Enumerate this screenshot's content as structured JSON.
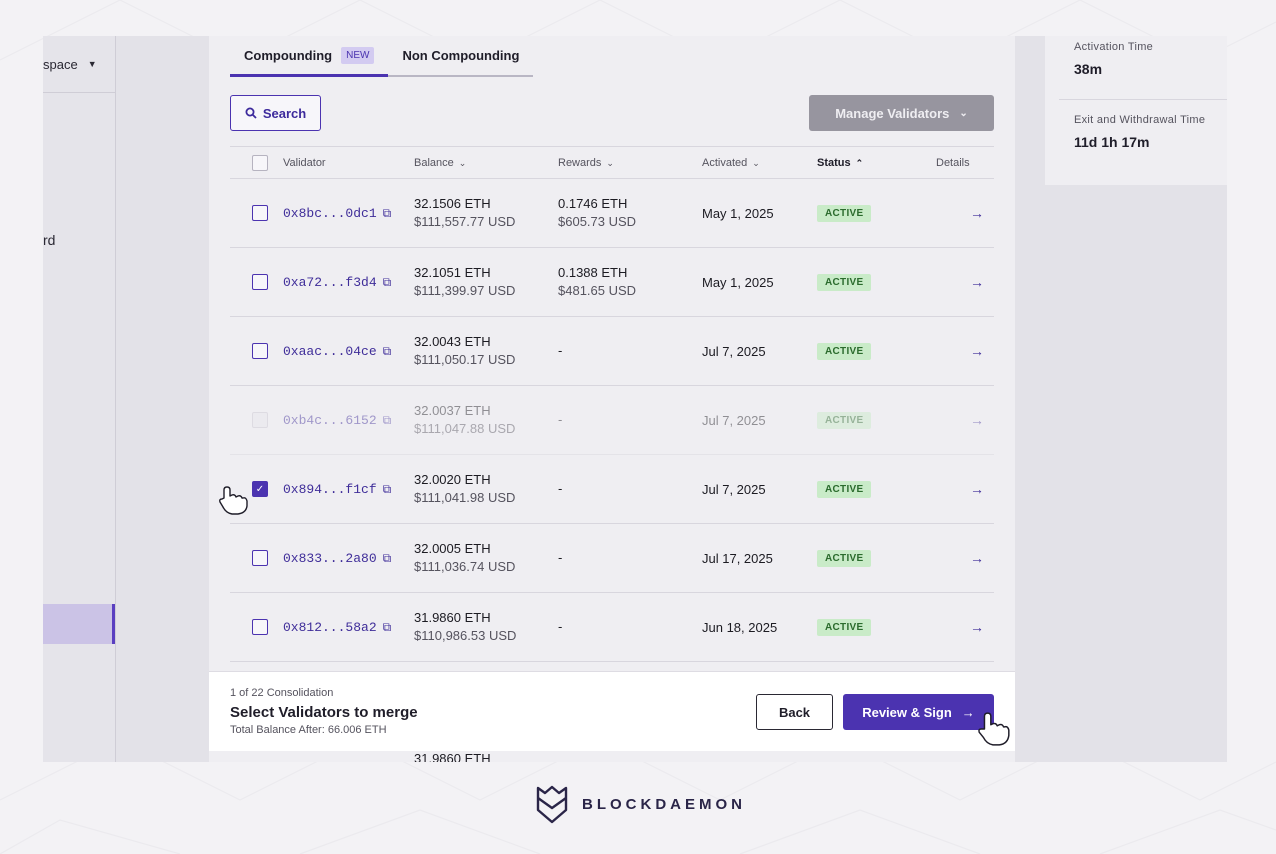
{
  "sidebar": {
    "workspace_label": "space",
    "partial_item": "rd"
  },
  "tabs": [
    {
      "label": "Compounding",
      "badge": "NEW"
    },
    {
      "label": "Non Compounding"
    }
  ],
  "toolbar": {
    "search_label": "Search",
    "manage_label": "Manage Validators"
  },
  "table": {
    "headers": {
      "validator": "Validator",
      "balance": "Balance",
      "rewards": "Rewards",
      "activated": "Activated",
      "status": "Status",
      "details": "Details"
    },
    "rows": [
      {
        "address": "0x8bc...0dc1",
        "balance_eth": "32.1506 ETH",
        "balance_usd": "$111,557.77 USD",
        "rewards_eth": "0.1746 ETH",
        "rewards_usd": "$605.73 USD",
        "activated": "May 1, 2025",
        "status": "ACTIVE"
      },
      {
        "address": "0xa72...f3d4",
        "balance_eth": "32.1051 ETH",
        "balance_usd": "$111,399.97 USD",
        "rewards_eth": "0.1388 ETH",
        "rewards_usd": "$481.65 USD",
        "activated": "May 1, 2025",
        "status": "ACTIVE"
      },
      {
        "address": "0xaac...04ce",
        "balance_eth": "32.0043 ETH",
        "balance_usd": "$111,050.17 USD",
        "rewards_eth": "-",
        "rewards_usd": "",
        "activated": "Jul 7, 2025",
        "status": "ACTIVE"
      },
      {
        "address": "0xb4c...6152",
        "balance_eth": "32.0037 ETH",
        "balance_usd": "$111,047.88 USD",
        "rewards_eth": "-",
        "rewards_usd": "",
        "activated": "Jul 7, 2025",
        "status": "ACTIVE"
      },
      {
        "address": "0x894...f1cf",
        "balance_eth": "32.0020 ETH",
        "balance_usd": "$111,041.98 USD",
        "rewards_eth": "-",
        "rewards_usd": "",
        "activated": "Jul 7, 2025",
        "status": "ACTIVE"
      },
      {
        "address": "0x833...2a80",
        "balance_eth": "32.0005 ETH",
        "balance_usd": "$111,036.74 USD",
        "rewards_eth": "-",
        "rewards_usd": "",
        "activated": "Jul 17, 2025",
        "status": "ACTIVE"
      },
      {
        "address": "0x812...58a2",
        "balance_eth": "31.9860 ETH",
        "balance_usd": "$110,986.53 USD",
        "rewards_eth": "-",
        "rewards_usd": "",
        "activated": "Jun 18, 2025",
        "status": "ACTIVE"
      }
    ],
    "peek_row": {
      "balance_eth": "31.9860 ETH"
    }
  },
  "footer": {
    "progress": "1 of 22 Consolidation",
    "title": "Select Validators to merge",
    "total": "Total Balance After: 66.006 ETH",
    "back_label": "Back",
    "review_label": "Review & Sign"
  },
  "right_panel": {
    "activation_label": "Activation Time",
    "activation_value": "38m",
    "exit_label": "Exit and Withdrawal Time",
    "exit_value": "11d 1h 17m"
  },
  "brand": {
    "name": "BLOCKDAEMON"
  },
  "colors": {
    "accent": "#4b33b0",
    "active_badge": "#c9ebc8",
    "background": "#f3f2f5"
  }
}
